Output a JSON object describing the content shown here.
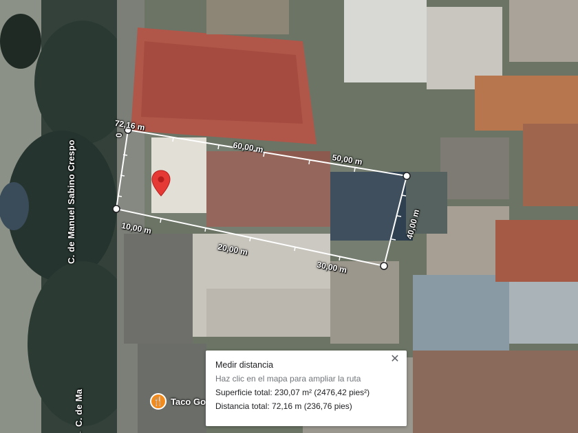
{
  "map": {
    "street_labels": [
      "C. de Manuel Sabino Crespo",
      "← C. de Ma"
    ],
    "measure_start_label": "72,16 m",
    "measure_zero_label": "0",
    "segment_labels": [
      "60,00 m",
      "50,00 m",
      "40,00 m",
      "30,00 m",
      "20,00 m",
      "10,00 m"
    ],
    "poi": {
      "icon": "restaurant-icon",
      "label": "Taco Go",
      "color": "#f28b1e"
    },
    "marker_color": "#e53935",
    "measure_line_color": "#ffffff"
  },
  "measure_panel": {
    "title": "Medir distancia",
    "hint": "Haz clic en el mapa para ampliar la ruta",
    "total_area": "Superficie total: 230,07 m² (2476,42 pies²)",
    "total_distance": "Distancia total: 72,16 m (236,76 pies)",
    "close_icon": "close-icon"
  }
}
